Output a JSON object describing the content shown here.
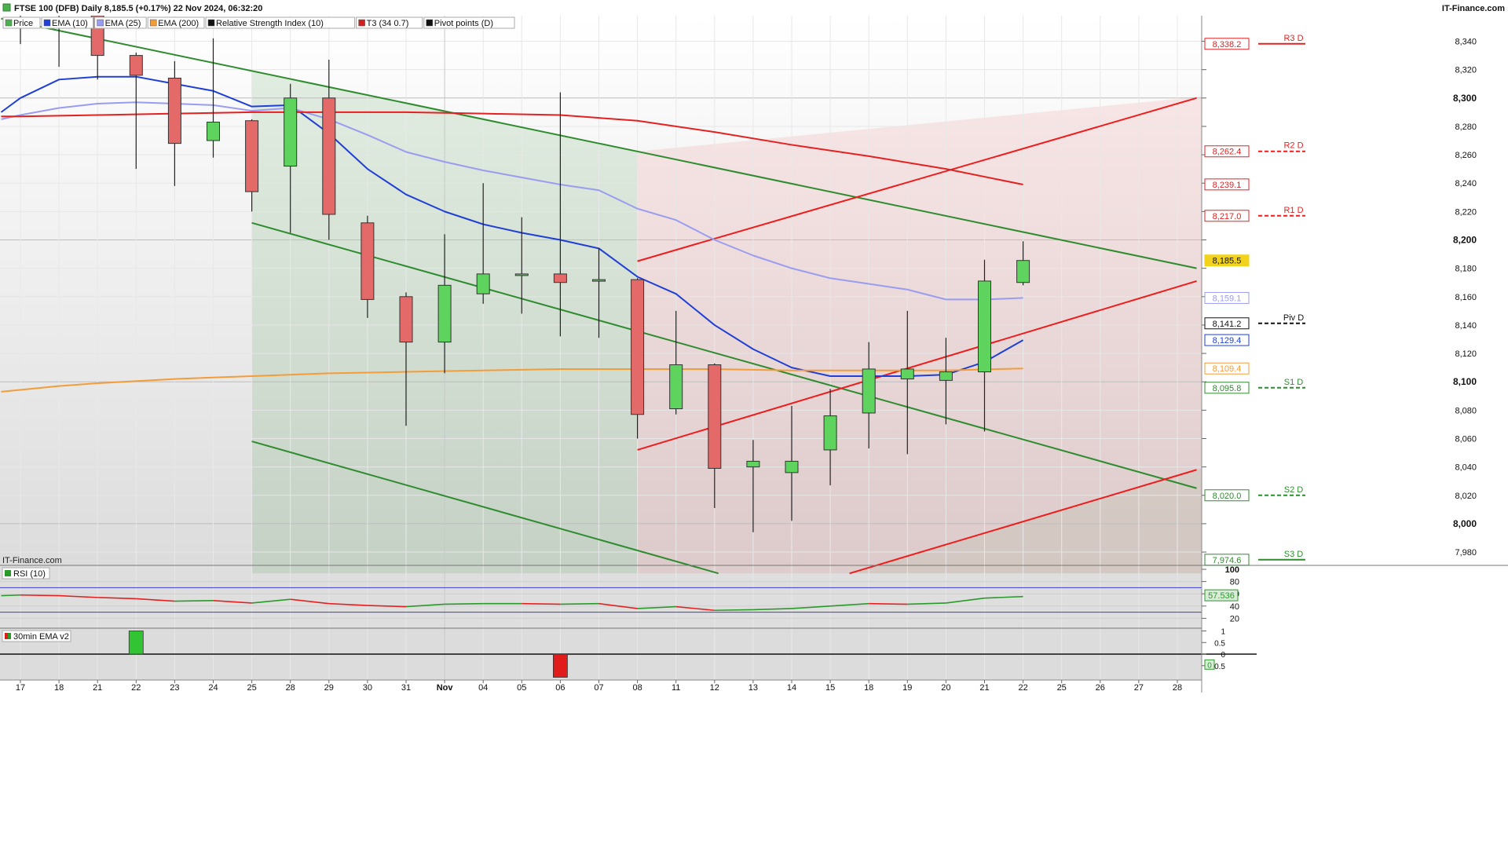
{
  "header": {
    "title": "FTSE 100 (DFB) Daily 8,185.5 (+0.17%) 22 Nov 2024, 06:32:20",
    "brand": "IT-Finance.com",
    "watermark": "IT-Finance.com",
    "legend": [
      {
        "label": "Price",
        "color": "#4caf50"
      },
      {
        "label": "EMA (10)",
        "color": "#1f3fd6"
      },
      {
        "label": "EMA (25)",
        "color": "#9a9cf0"
      },
      {
        "label": "EMA (200)",
        "color": "#f39c3a"
      },
      {
        "label": "Relative Strength Index (10)",
        "color": "#111111"
      },
      {
        "label": "T3 (34 0.7)",
        "color": "#d22020"
      },
      {
        "label": "Pivot points (D)",
        "color": "#111111"
      }
    ]
  },
  "colors": {
    "up": "#5ed45e",
    "down": "#e46a6a",
    "ema10": "#1f3fd6",
    "ema25": "#9a9cf0",
    "ema200": "#f39c3a",
    "t3": "#e52020",
    "channel_green": "#2e8b2e",
    "channel_red": "#ee1c1c"
  },
  "chart_data": [
    {
      "type": "candlestick",
      "title": "FTSE 100 (DFB) Daily",
      "ylim": [
        7965,
        8358
      ],
      "y_ticks": [
        7980,
        8000,
        8020,
        8040,
        8060,
        8080,
        8100,
        8120,
        8140,
        8160,
        8180,
        8200,
        8220,
        8240,
        8260,
        8280,
        8300,
        8320,
        8340
      ],
      "y_tick_labels": [
        "7,980",
        "8,000",
        "8,020",
        "8,040",
        "8,060",
        "8,080",
        "8,100",
        "8,120",
        "8,140",
        "8,160",
        "8,180",
        "8,200",
        "8,220",
        "8,240",
        "8,260",
        "8,280",
        "8,300",
        "8,320",
        "8,340"
      ],
      "bold_ticks": [
        8000,
        8100,
        8200,
        8300
      ],
      "x_labels": [
        "17",
        "18",
        "21",
        "22",
        "23",
        "24",
        "25",
        "28",
        "29",
        "30",
        "31",
        "Nov",
        "04",
        "05",
        "06",
        "07",
        "08",
        "11",
        "12",
        "13",
        "14",
        "15",
        "18",
        "19",
        "20",
        "21",
        "22",
        "25",
        "26",
        "27",
        "28"
      ],
      "bold_x_labels": [
        "Nov"
      ],
      "candles": [
        {
          "x": 0,
          "open": 8370,
          "high": 8380,
          "low": 8338,
          "close": 8365
        },
        {
          "x": 1,
          "open": 8375,
          "high": 8385,
          "low": 8322,
          "close": 8380
        },
        {
          "x": 2,
          "open": 8358,
          "high": 8370,
          "low": 8313,
          "close": 8330
        },
        {
          "x": 3,
          "open": 8330,
          "high": 8332,
          "low": 8250,
          "close": 8316
        },
        {
          "x": 4,
          "open": 8314,
          "high": 8326,
          "low": 8238,
          "close": 8268
        },
        {
          "x": 5,
          "open": 8270,
          "high": 8342,
          "low": 8258,
          "close": 8283
        },
        {
          "x": 6,
          "open": 8284,
          "high": 8285,
          "low": 8220,
          "close": 8234
        },
        {
          "x": 7,
          "open": 8252,
          "high": 8310,
          "low": 8205,
          "close": 8300
        },
        {
          "x": 8,
          "open": 8300,
          "high": 8327,
          "low": 8200,
          "close": 8218
        },
        {
          "x": 9,
          "open": 8212,
          "high": 8217,
          "low": 8145,
          "close": 8158
        },
        {
          "x": 10,
          "open": 8160,
          "high": 8163,
          "low": 8069,
          "close": 8128
        },
        {
          "x": 11,
          "open": 8128,
          "high": 8204,
          "low": 8106,
          "close": 8168
        },
        {
          "x": 12,
          "open": 8162,
          "high": 8240,
          "low": 8155,
          "close": 8176
        },
        {
          "x": 13,
          "open": 8175,
          "high": 8216,
          "low": 8148,
          "close": 8176
        },
        {
          "x": 14,
          "open": 8176,
          "high": 8304,
          "low": 8132,
          "close": 8170
        },
        {
          "x": 15,
          "open": 8172,
          "high": 8194,
          "low": 8131,
          "close": 8172
        },
        {
          "x": 16,
          "open": 8172,
          "high": 8173,
          "low": 8060,
          "close": 8077
        },
        {
          "x": 17,
          "open": 8081,
          "high": 8150,
          "low": 8077,
          "close": 8112
        },
        {
          "x": 18,
          "open": 8112,
          "high": 8113,
          "low": 8011,
          "close": 8039
        },
        {
          "x": 19,
          "open": 8040,
          "high": 8059,
          "low": 7994,
          "close": 8044
        },
        {
          "x": 20,
          "open": 8036,
          "high": 8083,
          "low": 8002,
          "close": 8044
        },
        {
          "x": 21,
          "open": 8052,
          "high": 8095,
          "low": 8027,
          "close": 8076
        },
        {
          "x": 22,
          "open": 8078,
          "high": 8128,
          "low": 8053,
          "close": 8109
        },
        {
          "x": 23,
          "open": 8102,
          "high": 8150,
          "low": 8049,
          "close": 8109
        },
        {
          "x": 24,
          "open": 8101,
          "high": 8131,
          "low": 8070,
          "close": 8107
        },
        {
          "x": 25,
          "open": 8107,
          "high": 8186,
          "low": 8065,
          "close": 8171
        },
        {
          "x": 26,
          "open": 8170,
          "high": 8199,
          "low": 8168,
          "close": 8185.5
        }
      ],
      "series": [
        {
          "name": "EMA (10)",
          "color": "#1f3fd6",
          "points": [
            [
              -0.5,
              8290
            ],
            [
              0,
              8300
            ],
            [
              1,
              8313
            ],
            [
              2,
              8315
            ],
            [
              3,
              8315
            ],
            [
              4,
              8310
            ],
            [
              5,
              8305
            ],
            [
              6,
              8294
            ],
            [
              7,
              8295
            ],
            [
              8,
              8275
            ],
            [
              9,
              8250
            ],
            [
              10,
              8232
            ],
            [
              11,
              8220
            ],
            [
              12,
              8211
            ],
            [
              13,
              8205
            ],
            [
              14,
              8200
            ],
            [
              15,
              8194
            ],
            [
              16,
              8174
            ],
            [
              17,
              8162
            ],
            [
              18,
              8140
            ],
            [
              19,
              8123
            ],
            [
              20,
              8110
            ],
            [
              21,
              8104
            ],
            [
              22,
              8104
            ],
            [
              23,
              8104
            ],
            [
              24,
              8105
            ],
            [
              25,
              8114
            ],
            [
              26,
              8129.4
            ]
          ]
        },
        {
          "name": "EMA (25)",
          "color": "#9a9cf0",
          "points": [
            [
              -0.5,
              8285
            ],
            [
              0,
              8288
            ],
            [
              1,
              8293
            ],
            [
              2,
              8296
            ],
            [
              3,
              8297
            ],
            [
              4,
              8296
            ],
            [
              5,
              8295
            ],
            [
              6,
              8291
            ],
            [
              7,
              8293
            ],
            [
              8,
              8285
            ],
            [
              9,
              8274
            ],
            [
              10,
              8262
            ],
            [
              11,
              8255
            ],
            [
              12,
              8249
            ],
            [
              13,
              8244
            ],
            [
              14,
              8239
            ],
            [
              15,
              8235
            ],
            [
              16,
              8222
            ],
            [
              17,
              8214
            ],
            [
              18,
              8200
            ],
            [
              19,
              8189
            ],
            [
              20,
              8180
            ],
            [
              21,
              8173
            ],
            [
              22,
              8169
            ],
            [
              23,
              8165
            ],
            [
              24,
              8158
            ],
            [
              25,
              8158
            ],
            [
              26,
              8159.1
            ]
          ]
        },
        {
          "name": "EMA (200)",
          "color": "#f39c3a",
          "points": [
            [
              -0.5,
              8093
            ],
            [
              1,
              8097
            ],
            [
              2,
              8099
            ],
            [
              4,
              8102
            ],
            [
              6,
              8104
            ],
            [
              8,
              8106
            ],
            [
              10,
              8107
            ],
            [
              12,
              8108
            ],
            [
              14,
              8109
            ],
            [
              16,
              8109
            ],
            [
              18,
              8109
            ],
            [
              20,
              8108
            ],
            [
              22,
              8108
            ],
            [
              24,
              8108
            ],
            [
              26,
              8109.4
            ]
          ]
        },
        {
          "name": "T3 (34 0.7)",
          "color": "#e52020",
          "points": [
            [
              -0.5,
              8287
            ],
            [
              0,
              8287
            ],
            [
              2,
              8288
            ],
            [
              4,
              8289
            ],
            [
              6,
              8290
            ],
            [
              8,
              8290
            ],
            [
              10,
              8290
            ],
            [
              12,
              8289
            ],
            [
              14,
              8288
            ],
            [
              16,
              8284
            ],
            [
              18,
              8276
            ],
            [
              20,
              8267
            ],
            [
              22,
              8259
            ],
            [
              24,
              8250
            ],
            [
              26,
              8239
            ]
          ]
        }
      ],
      "channels": [
        {
          "name": "green-upper",
          "color": "#2e8b2e",
          "start": [
            -0.5,
            8356
          ],
          "end": [
            30.5,
            8180
          ]
        },
        {
          "name": "green-middle",
          "color": "#2e8b2e",
          "start": [
            6,
            8212
          ],
          "end": [
            30.5,
            8025
          ]
        },
        {
          "name": "green-lower",
          "color": "#2e8b2e",
          "start": [
            6,
            8058
          ],
          "end": [
            18.1,
            7965
          ]
        },
        {
          "name": "red-upper",
          "color": "#ee1c1c",
          "start": [
            16,
            8185
          ],
          "end": [
            30.5,
            8300
          ]
        },
        {
          "name": "red-middle",
          "color": "#ee1c1c",
          "start": [
            16,
            8052
          ],
          "end": [
            30.5,
            8171
          ]
        },
        {
          "name": "red-lower",
          "color": "#ee1c1c",
          "start": [
            21.5,
            7965
          ],
          "end": [
            30.5,
            8038
          ]
        }
      ],
      "shaded_regions": [
        {
          "name": "green-channel-fill",
          "color": "#2e8b2e"
        },
        {
          "name": "red-channel-fill",
          "color": "#ee1c1c"
        }
      ],
      "pivots": [
        {
          "name": "R3 D",
          "value": 8338.2,
          "label": "8,338.2",
          "color": "#e52020",
          "style": "solid"
        },
        {
          "name": "R2 D",
          "value": 8262.4,
          "label": "8,262.4",
          "color": "#e52020",
          "style": "dashed"
        },
        {
          "name": "R1 D",
          "value": 8217.0,
          "label": "8,217.0",
          "color": "#e52020",
          "style": "dashed"
        },
        {
          "name": "Piv D",
          "value": 8141.2,
          "label": "8,141.2",
          "color": "#111111",
          "style": "dashed"
        },
        {
          "name": "S1 D",
          "value": 8095.8,
          "label": "8,095.8",
          "color": "#2e8b2e",
          "style": "dashed"
        },
        {
          "name": "S2 D",
          "value": 8020.0,
          "label": "8,020.0",
          "color": "#2e8b2e",
          "style": "dashed"
        },
        {
          "name": "S3 D",
          "value": 7974.6,
          "label": "7,974.6",
          "color": "#2e8b2e",
          "style": "solid"
        }
      ],
      "price_tags": [
        {
          "value": 8239.1,
          "label": "8,239.1",
          "color": "#e52020",
          "style": "outline"
        },
        {
          "value": 8185.5,
          "label": "8,185.5",
          "color": "#f2d21a",
          "style": "filled"
        },
        {
          "value": 8159.1,
          "label": "8,159.1",
          "color": "#9a9cf0",
          "style": "outline"
        },
        {
          "value": 8129.4,
          "label": "8,129.4",
          "color": "#1f3fd6",
          "style": "outline"
        },
        {
          "value": 8109.4,
          "label": "8,109.4",
          "color": "#f39c3a",
          "style": "outline"
        }
      ]
    },
    {
      "type": "line",
      "title": "RSI (10)",
      "ylim": [
        0,
        100
      ],
      "y_ticks": [
        100,
        80,
        60,
        40,
        20
      ],
      "bands": [
        30,
        70
      ],
      "last_value": 57.536,
      "last_label": "57.536",
      "values": [
        [
          -0.5,
          57
        ],
        [
          0,
          58
        ],
        [
          1,
          57
        ],
        [
          2,
          54
        ],
        [
          3,
          52
        ],
        [
          4,
          48
        ],
        [
          5,
          49
        ],
        [
          6,
          45
        ],
        [
          7,
          51
        ],
        [
          8,
          44
        ],
        [
          9,
          41
        ],
        [
          10,
          39
        ],
        [
          11,
          43
        ],
        [
          12,
          44
        ],
        [
          13,
          44
        ],
        [
          14,
          43
        ],
        [
          15,
          44
        ],
        [
          16,
          36
        ],
        [
          17,
          39
        ],
        [
          18,
          33
        ],
        [
          19,
          34
        ],
        [
          20,
          36
        ],
        [
          21,
          40
        ],
        [
          22,
          44
        ],
        [
          23,
          43
        ],
        [
          24,
          45
        ],
        [
          25,
          53
        ],
        [
          26,
          55.5
        ]
      ],
      "above_color": "#2a9a2a",
      "below_color": "#e52020"
    },
    {
      "type": "bar",
      "title": "30min EMA v2",
      "ylim": [
        -1,
        1
      ],
      "y_ticks": [
        1,
        0.5,
        0,
        -0.5
      ],
      "y_tick_labels": [
        "1",
        "0.5",
        "0",
        "-0.5"
      ],
      "bars": [
        {
          "x": 3,
          "value": 1
        },
        {
          "x": 14,
          "value": -1
        }
      ],
      "last_label": "0"
    }
  ]
}
